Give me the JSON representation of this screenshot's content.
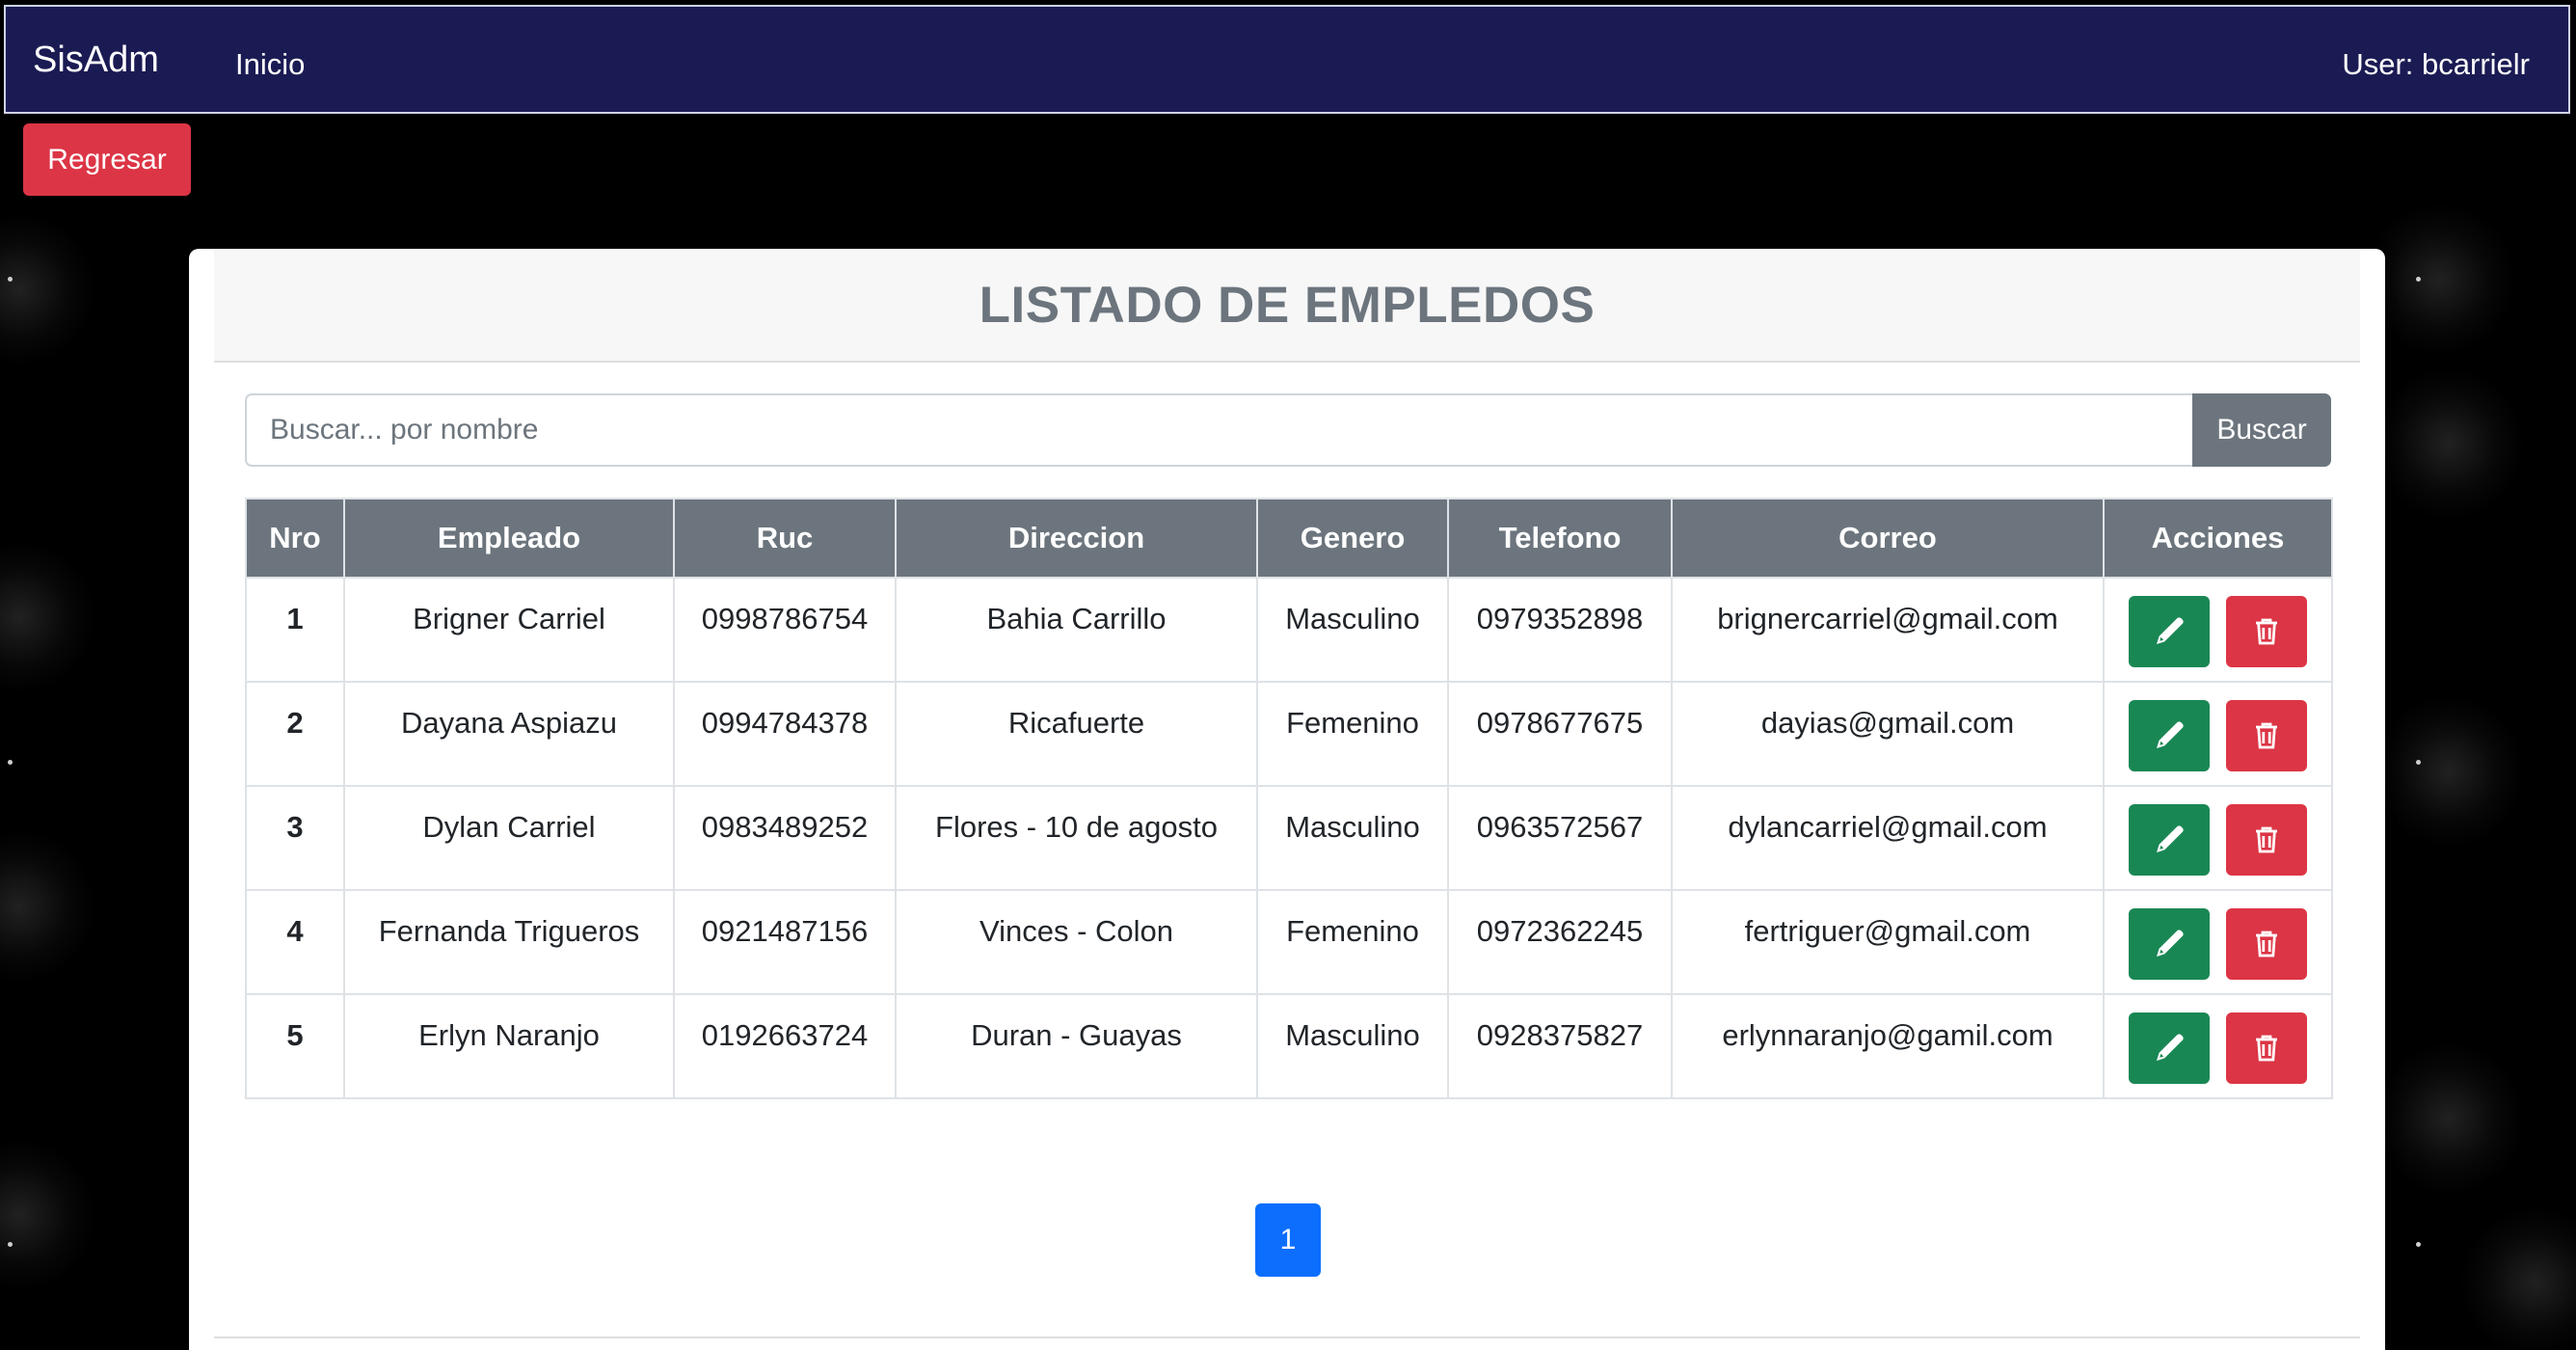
{
  "navbar": {
    "brand": "SisAdm",
    "link_home": "Inicio",
    "user": "User: bcarrielr"
  },
  "back_button": "Regresar",
  "card": {
    "title": "LISTADO DE EMPLEDOS"
  },
  "search": {
    "placeholder": "Buscar... por nombre",
    "value": "",
    "button": "Buscar"
  },
  "table": {
    "headers": [
      "Nro",
      "Empleado",
      "Ruc",
      "Direccion",
      "Genero",
      "Telefono",
      "Correo",
      "Acciones"
    ],
    "rows": [
      {
        "nro": "1",
        "empleado": "Brigner Carriel",
        "ruc": "0998786754",
        "direccion": "Bahia Carrillo",
        "genero": "Masculino",
        "telefono": "0979352898",
        "correo": "brignercarriel@gmail.com"
      },
      {
        "nro": "2",
        "empleado": "Dayana Aspiazu",
        "ruc": "0994784378",
        "direccion": "Ricafuerte",
        "genero": "Femenino",
        "telefono": "0978677675",
        "correo": "dayias@gmail.com"
      },
      {
        "nro": "3",
        "empleado": "Dylan Carriel",
        "ruc": "0983489252",
        "direccion": "Flores - 10 de agosto",
        "genero": "Masculino",
        "telefono": "0963572567",
        "correo": "dylancarriel@gmail.com"
      },
      {
        "nro": "4",
        "empleado": "Fernanda Trigueros",
        "ruc": "0921487156",
        "direccion": "Vinces - Colon",
        "genero": "Femenino",
        "telefono": "0972362245",
        "correo": "fertriguer@gmail.com"
      },
      {
        "nro": "5",
        "empleado": "Erlyn Naranjo",
        "ruc": "0192663724",
        "direccion": "Duran - Guayas",
        "genero": "Masculino",
        "telefono": "0928375827",
        "correo": "erlynnaranjo@gamil.com"
      }
    ]
  },
  "actions": {
    "edit_icon": "pencil-icon",
    "delete_icon": "trash-icon"
  },
  "pagination": {
    "current_page": "1"
  },
  "colors": {
    "navbar": "#1b1b54",
    "danger": "#dc3545",
    "success": "#198754",
    "secondary": "#6c757d",
    "primary": "#0d6efd"
  }
}
